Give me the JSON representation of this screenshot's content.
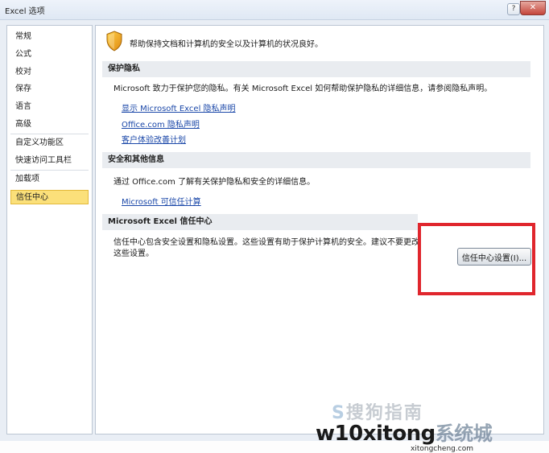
{
  "window": {
    "title": "Excel 选项",
    "help_glyph": "?",
    "close_glyph": "✕"
  },
  "sidebar": {
    "items": [
      {
        "label": "常规"
      },
      {
        "label": "公式"
      },
      {
        "label": "校对"
      },
      {
        "label": "保存"
      },
      {
        "label": "语言"
      },
      {
        "label": "高级"
      },
      {
        "label": "自定义功能区"
      },
      {
        "label": "快速访问工具栏"
      },
      {
        "label": "加载项"
      },
      {
        "label": "信任中心",
        "active": true
      }
    ]
  },
  "content": {
    "intro": "帮助保持文档和计算机的安全以及计算机的状况良好。",
    "privacy": {
      "header": "保护隐私",
      "text": "Microsoft 致力于保护您的隐私。有关 Microsoft Excel 如何帮助保护隐私的详细信息，请参阅隐私声明。",
      "links": [
        "显示 Microsoft Excel 隐私声明",
        "Office.com 隐私声明",
        "客户体验改善计划"
      ]
    },
    "security": {
      "header": "安全和其他信息",
      "text": "通过 Office.com 了解有关保护隐私和安全的详细信息。",
      "link": "Microsoft 可信任计算"
    },
    "trust_center": {
      "header": "Microsoft Excel 信任中心",
      "text_line1": "信任中心包含安全设置和隐私设置。这些设置有助于保护计算机的安全。建议不要更改",
      "text_line2": "这些设置。",
      "button_label": "信任中心设置(I)..."
    }
  },
  "watermark": {
    "line1_prefix": "S",
    "line1": "搜狗指南",
    "line2_latin": "w10xitong",
    "line2_cn": "系统城",
    "line3": "xitongcheng.com"
  },
  "colors": {
    "highlight": "#e0262d",
    "link": "#1a47a8",
    "active_item": "#fbe07a"
  }
}
